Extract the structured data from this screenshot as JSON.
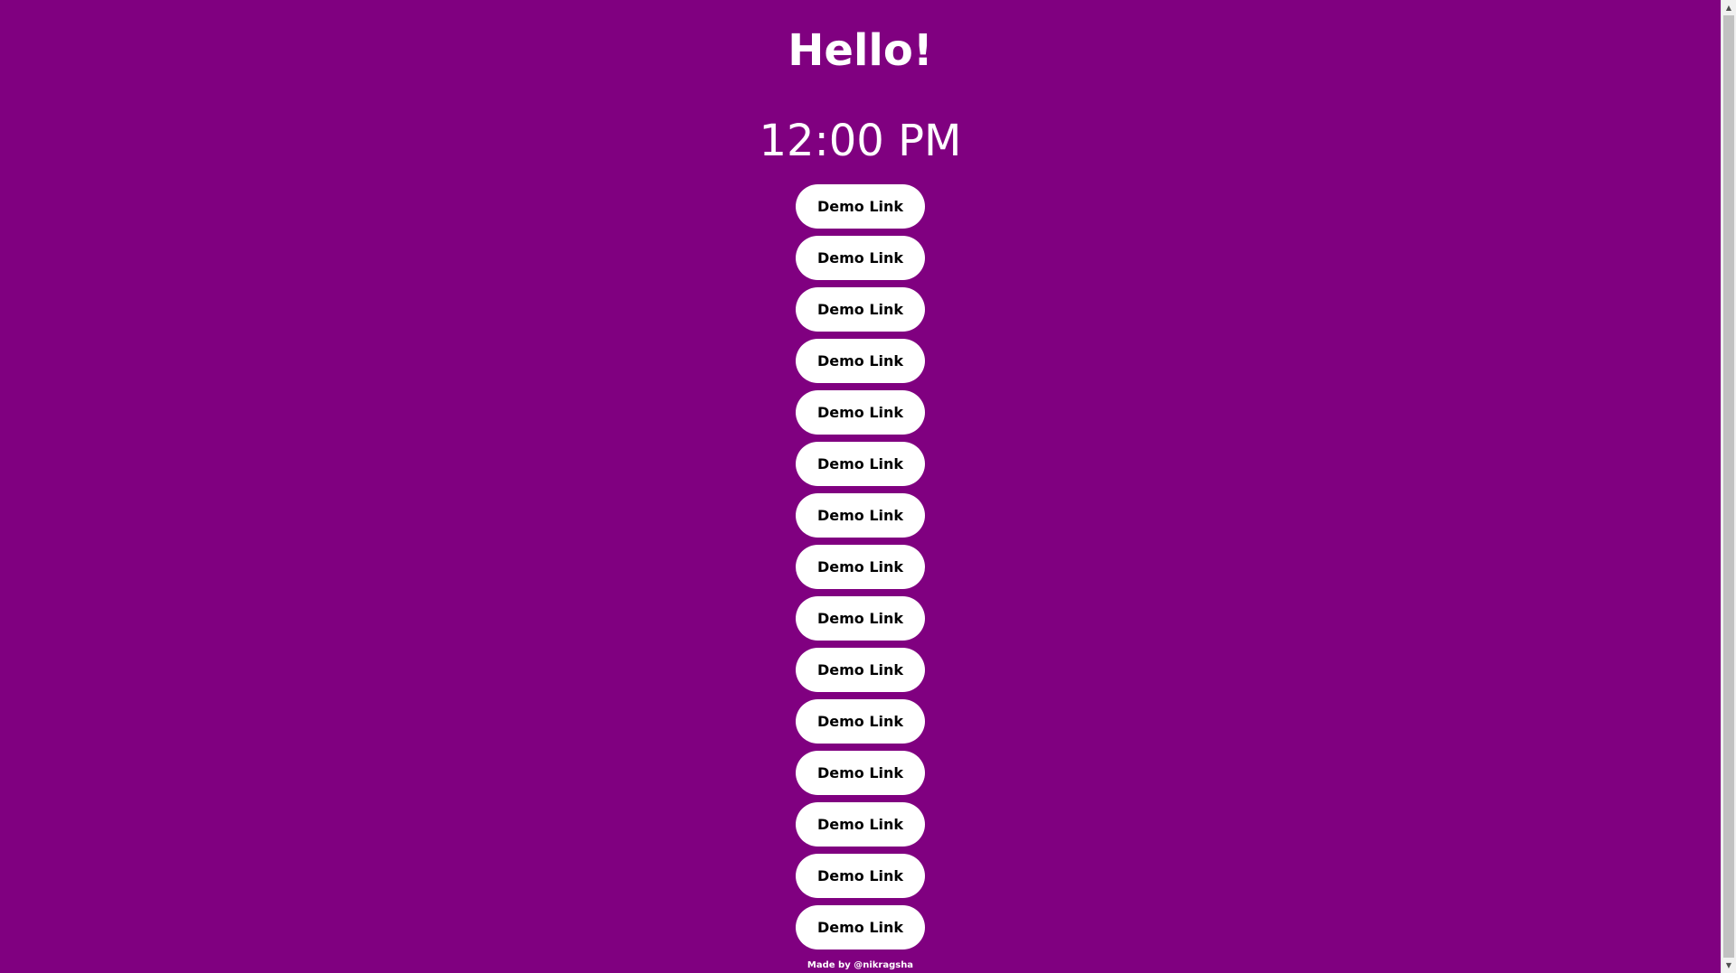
{
  "page": {
    "greeting": "Hello!",
    "clock": "12:00 PM",
    "background_color": "#800080"
  },
  "links": [
    {
      "label": "Demo Link"
    },
    {
      "label": "Demo Link"
    },
    {
      "label": "Demo Link"
    },
    {
      "label": "Demo Link"
    },
    {
      "label": "Demo Link"
    },
    {
      "label": "Demo Link"
    },
    {
      "label": "Demo Link"
    },
    {
      "label": "Demo Link"
    },
    {
      "label": "Demo Link"
    },
    {
      "label": "Demo Link"
    },
    {
      "label": "Demo Link"
    },
    {
      "label": "Demo Link"
    },
    {
      "label": "Demo Link"
    },
    {
      "label": "Demo Link"
    },
    {
      "label": "Demo Link"
    }
  ],
  "footer": {
    "credit": "Made by @nikragsha"
  },
  "scrollbar": {
    "up_icon": "triangle-up-icon",
    "down_icon": "triangle-down-icon"
  }
}
